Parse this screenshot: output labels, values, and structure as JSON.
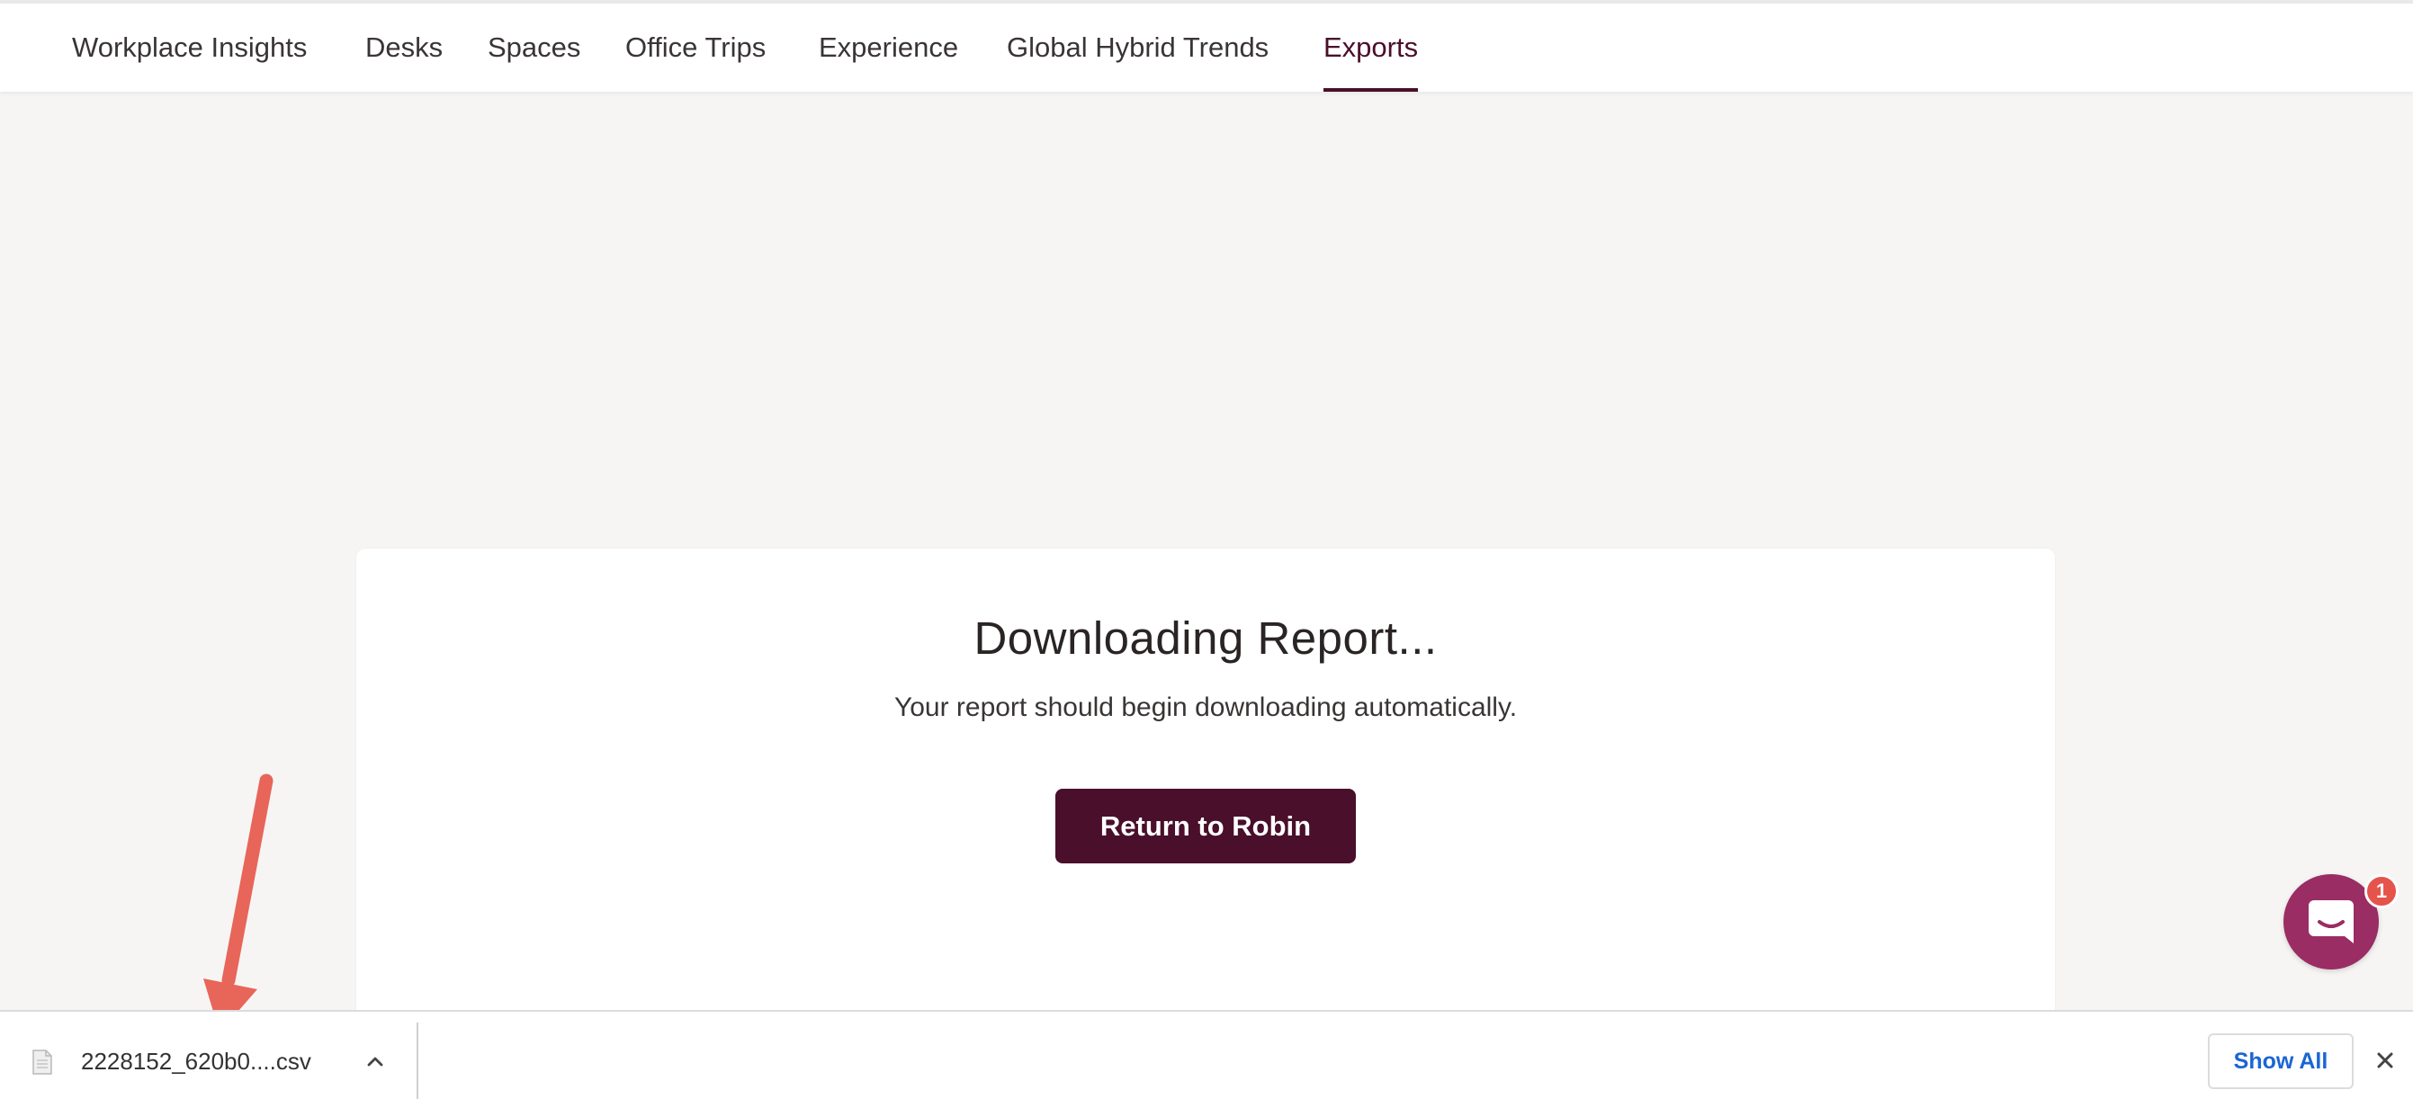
{
  "nav": {
    "items": [
      {
        "label": "Workplace Insights",
        "active": false
      },
      {
        "label": "Desks",
        "active": false
      },
      {
        "label": "Spaces",
        "active": false
      },
      {
        "label": "Office Trips",
        "active": false
      },
      {
        "label": "Experience",
        "active": false
      },
      {
        "label": "Global Hybrid Trends",
        "active": false
      },
      {
        "label": "Exports",
        "active": true
      }
    ]
  },
  "report": {
    "title": "Downloading Report...",
    "subtitle": "Your report should begin downloading automatically.",
    "return_label": "Return to Robin"
  },
  "chat": {
    "icon": "chat-bubble-icon",
    "badge_count": "1"
  },
  "download_bar": {
    "file_name": "2228152_620b0....csv",
    "file_icon": "document-icon",
    "show_all_label": "Show All",
    "close_icon": "close-icon",
    "chevron_icon": "chevron-up-icon"
  },
  "colors": {
    "brand": "#4a0f2a",
    "chat": "#9a2d63",
    "badge": "#e5534b",
    "link": "#1a66d2",
    "arrow": "#e8655a",
    "background": "#f6f5f3"
  }
}
